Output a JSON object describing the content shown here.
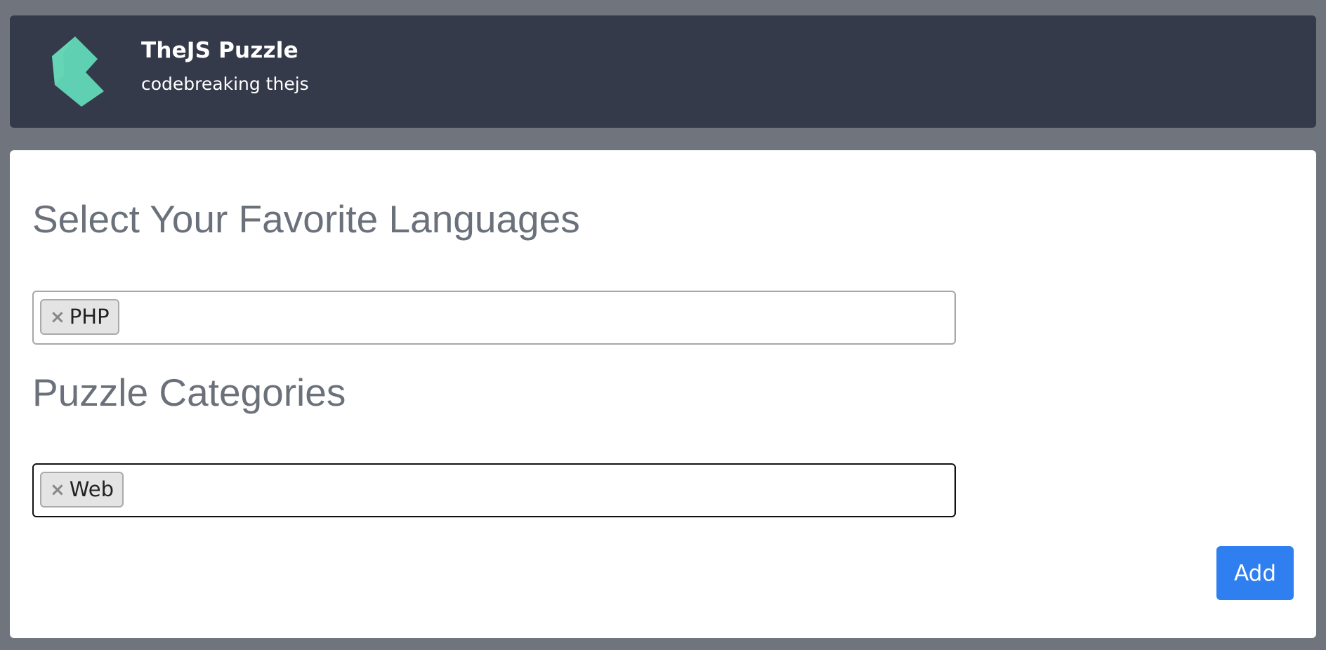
{
  "header": {
    "title": "TheJS Puzzle",
    "subtitle": "codebreaking thejs",
    "logo_icon": "gem-logo-icon",
    "logo_color": "#5fd0b2"
  },
  "languages": {
    "heading": "Select Your Favorite Languages",
    "selected": [
      {
        "remove_label": "×",
        "label": "PHP"
      }
    ]
  },
  "categories": {
    "heading": "Puzzle Categories",
    "selected": [
      {
        "remove_label": "×",
        "label": "Web"
      }
    ]
  },
  "actions": {
    "add_label": "Add",
    "add_color": "#2f7ff0"
  },
  "colors": {
    "page_bg": "#70757d",
    "header_bg": "#353a4a",
    "heading_text": "#6b717b"
  }
}
